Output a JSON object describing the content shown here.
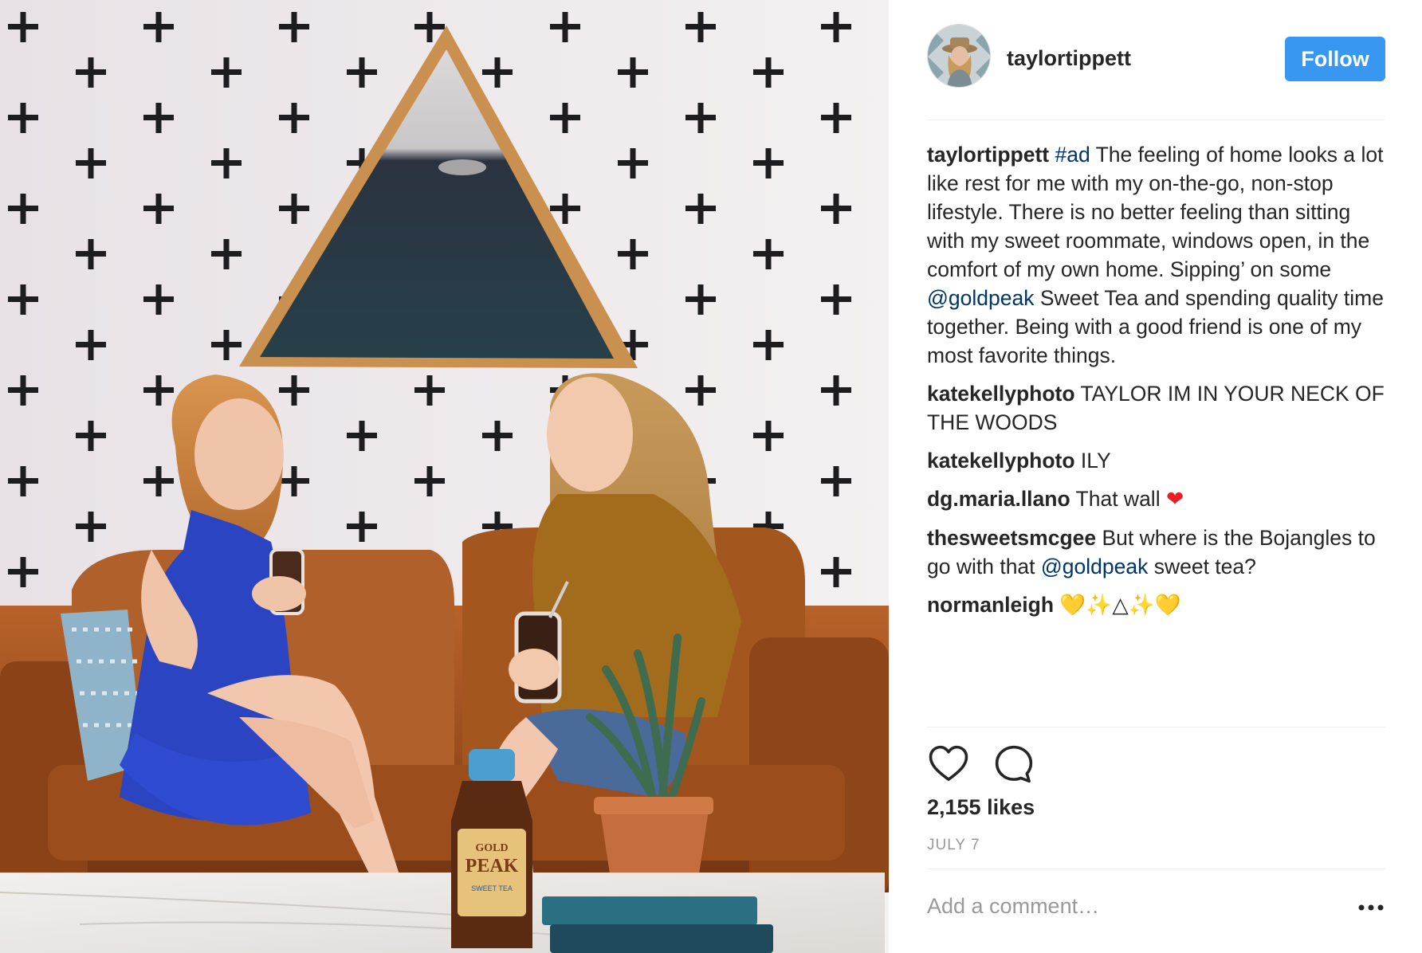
{
  "post": {
    "username": "taylortippett",
    "follow_label": "Follow",
    "accent_color": "#3897f0",
    "link_color": "#003569"
  },
  "caption": {
    "user": "taylortippett",
    "hashtag": "#ad",
    "text_1": " The feeling of home looks a lot like rest for me with my on-the-go, non-stop lifestyle. There is no better feeling than sitting with my sweet roommate, windows open, in the comfort of my own home. Sipping’ on some ",
    "mention": "@goldpeak",
    "text_2": " Sweet Tea and spending quality time together. Being with a good friend is one of my most favorite things."
  },
  "comments": [
    {
      "user": "katekellyphoto",
      "text": " TAYLOR IM IN YOUR NECK OF THE WOODS"
    },
    {
      "user": "katekellyphoto",
      "text": " ILY"
    },
    {
      "user": "dg.maria.llano",
      "text": " That wall ",
      "emoji": "❤"
    },
    {
      "user": "thesweetsmcgee",
      "text_1": " But where is the Bojangles to go with that ",
      "mention": "@goldpeak",
      "text_2": " sweet tea?"
    },
    {
      "user": "normanleigh",
      "emoji_1": "💛",
      "emoji_2": "✨",
      "emoji_3": "△",
      "emoji_4": "✨",
      "emoji_5": "💛"
    }
  ],
  "stats": {
    "likes": "2,155 likes",
    "date": "JULY 7"
  },
  "comment_box": {
    "placeholder": "Add a comment…"
  },
  "icons": {
    "like": "heart-outline-icon",
    "comment": "speech-bubble-icon",
    "more": "more-options-icon"
  },
  "photo_text": {
    "bottle_brand_1": "GOLD",
    "bottle_brand_2": "PEAK",
    "bottle_sub": "SWEET TEA"
  }
}
